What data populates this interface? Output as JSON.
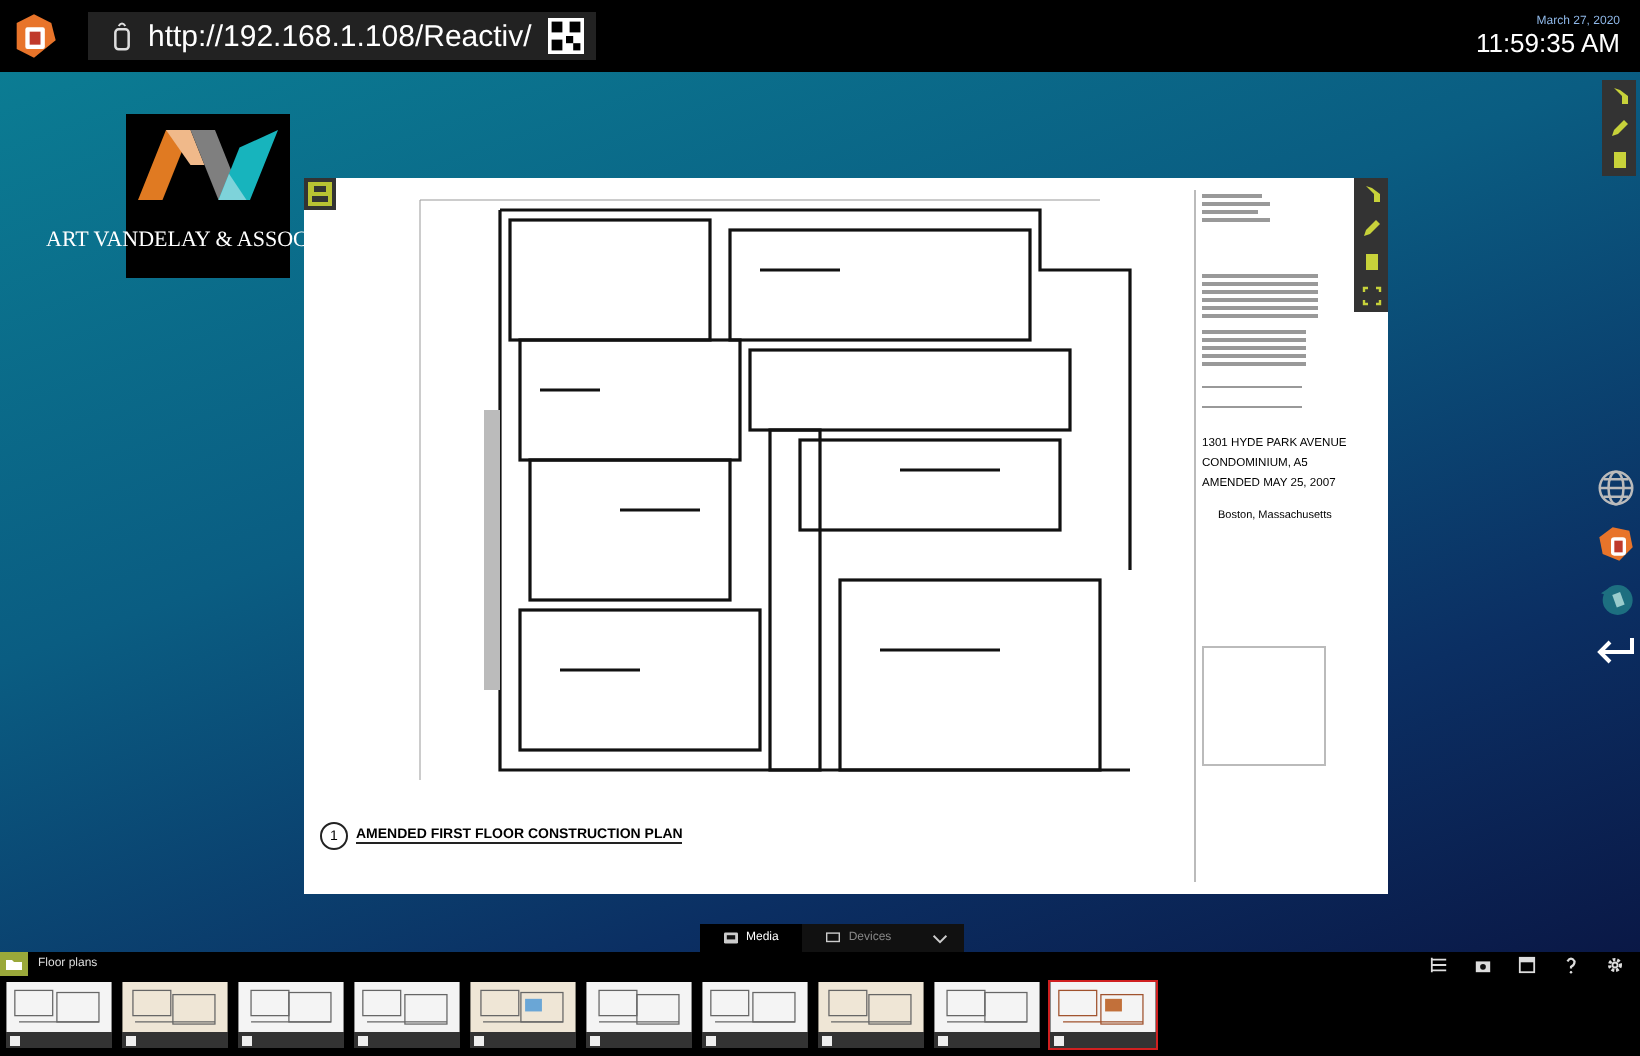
{
  "browser": {
    "url": "http://192.168.1.108/Reactiv/"
  },
  "clock": {
    "date": "March 27, 2020",
    "time": "11:59:35 AM"
  },
  "logo": {
    "company": "ART VANDELAY & ASSOC"
  },
  "document": {
    "title_block": {
      "project_lines": [
        "1301 HYDE PARK AVENUE",
        "CONDOMINIUM, A5",
        "AMENDED MAY 25, 2007"
      ],
      "location": "Boston, Massachusetts"
    },
    "plan": {
      "number": "1",
      "title": "AMENDED FIRST FLOOR CONSTRUCTION PLAN"
    }
  },
  "bottom_tabs": [
    {
      "label": "Media",
      "selected": true
    },
    {
      "label": "Devices",
      "selected": false
    }
  ],
  "folder": {
    "label": "Floor plans"
  },
  "thumbnails": [
    {
      "selected": false
    },
    {
      "selected": false
    },
    {
      "selected": false
    },
    {
      "selected": false
    },
    {
      "selected": false
    },
    {
      "selected": false
    },
    {
      "selected": false
    },
    {
      "selected": false
    },
    {
      "selected": false
    },
    {
      "selected": true
    }
  ]
}
